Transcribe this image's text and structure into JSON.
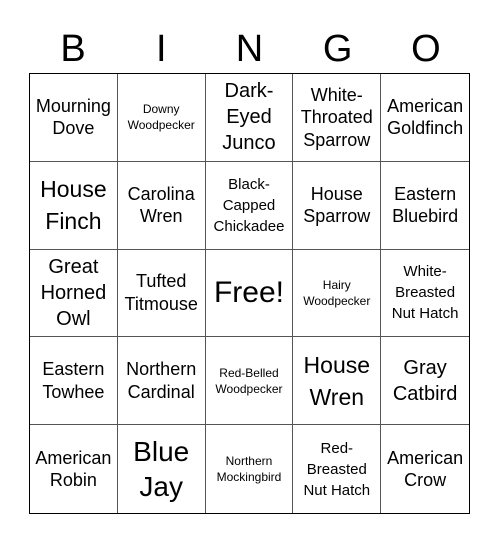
{
  "header": [
    "B",
    "I",
    "N",
    "G",
    "O"
  ],
  "cells": [
    {
      "text": "Mourning Dove",
      "size": "m"
    },
    {
      "text": "Downy Woodpecker",
      "size": "xs"
    },
    {
      "text": "Dark-Eyed Junco",
      "size": "l"
    },
    {
      "text": "White-Throated Sparrow",
      "size": "m"
    },
    {
      "text": "American Goldfinch",
      "size": "m"
    },
    {
      "text": "House Finch",
      "size": "xl"
    },
    {
      "text": "Carolina Wren",
      "size": "m"
    },
    {
      "text": "Black-Capped Chickadee",
      "size": "s"
    },
    {
      "text": "House Sparrow",
      "size": "m"
    },
    {
      "text": "Eastern Bluebird",
      "size": "m"
    },
    {
      "text": "Great Horned Owl",
      "size": "l"
    },
    {
      "text": "Tufted Titmouse",
      "size": "m"
    },
    {
      "text": "Free!",
      "size": "free"
    },
    {
      "text": "Hairy Woodpecker",
      "size": "xs"
    },
    {
      "text": "White-Breasted Nut Hatch",
      "size": "s"
    },
    {
      "text": "Eastern Towhee",
      "size": "m"
    },
    {
      "text": "Northern Cardinal",
      "size": "m"
    },
    {
      "text": "Red-Belled Woodpecker",
      "size": "xs"
    },
    {
      "text": "House Wren",
      "size": "xl"
    },
    {
      "text": "Gray Catbird",
      "size": "l"
    },
    {
      "text": "American Robin",
      "size": "m"
    },
    {
      "text": "Blue Jay",
      "size": "xxl"
    },
    {
      "text": "Northern Mockingbird",
      "size": "xs"
    },
    {
      "text": "Red-Breasted Nut Hatch",
      "size": "s"
    },
    {
      "text": "American Crow",
      "size": "m"
    }
  ]
}
